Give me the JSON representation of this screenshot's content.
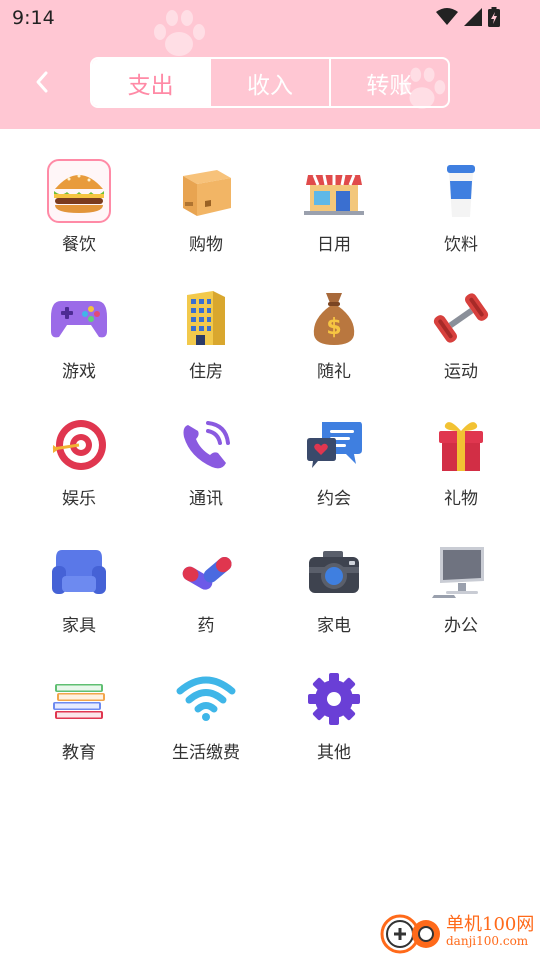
{
  "status_bar": {
    "time": "9:14"
  },
  "header": {
    "tabs": [
      {
        "label": "支出",
        "active": true
      },
      {
        "label": "收入",
        "active": false
      },
      {
        "label": "转账",
        "active": false
      }
    ]
  },
  "categories": [
    {
      "label": "餐饮",
      "icon": "burger-icon",
      "selected": true
    },
    {
      "label": "购物",
      "icon": "box-icon"
    },
    {
      "label": "日用",
      "icon": "store-icon"
    },
    {
      "label": "饮料",
      "icon": "cup-icon"
    },
    {
      "label": "游戏",
      "icon": "gamepad-icon"
    },
    {
      "label": "住房",
      "icon": "building-icon"
    },
    {
      "label": "随礼",
      "icon": "money-bag-icon"
    },
    {
      "label": "运动",
      "icon": "dumbbell-icon"
    },
    {
      "label": "娱乐",
      "icon": "target-icon"
    },
    {
      "label": "通讯",
      "icon": "phone-icon"
    },
    {
      "label": "约会",
      "icon": "chat-icon"
    },
    {
      "label": "礼物",
      "icon": "gift-icon"
    },
    {
      "label": "家具",
      "icon": "armchair-icon"
    },
    {
      "label": "药",
      "icon": "pill-icon"
    },
    {
      "label": "家电",
      "icon": "camera-icon"
    },
    {
      "label": "办公",
      "icon": "monitor-icon"
    },
    {
      "label": "教育",
      "icon": "books-icon"
    },
    {
      "label": "生活缴费",
      "icon": "wifi-icon"
    },
    {
      "label": "其他",
      "icon": "gear-icon"
    }
  ],
  "watermark": {
    "brand": "单机100网",
    "url": "danji100.com"
  },
  "colors": {
    "header_bg": "#ffc7d3",
    "accent": "#ff8aa6"
  }
}
